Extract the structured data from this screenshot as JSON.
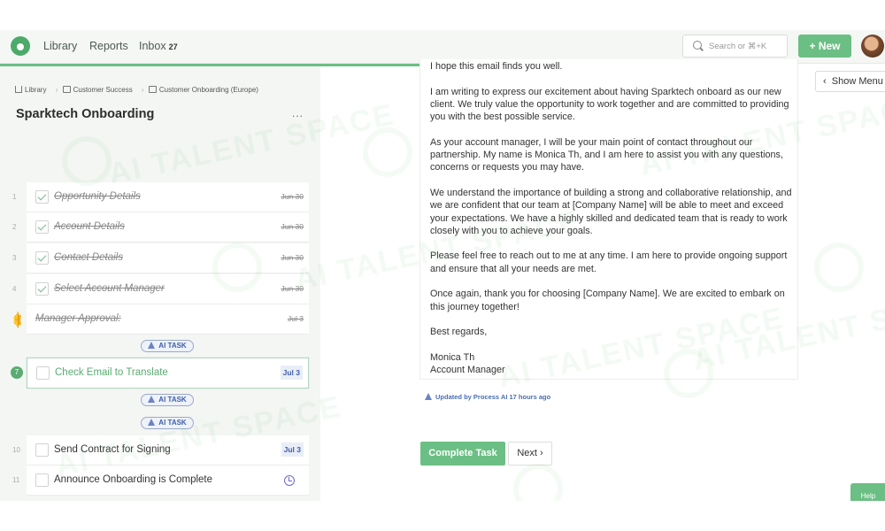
{
  "topbar": {
    "nav": [
      {
        "label": "Library"
      },
      {
        "label": "Reports"
      },
      {
        "label": "Inbox",
        "badge": "27"
      }
    ],
    "search_placeholder": "Search or ⌘+K",
    "new_label": "+ New"
  },
  "breadcrumb": {
    "items": [
      "Library",
      "Customer Success",
      "Customer Onboarding (Europe)"
    ]
  },
  "project": {
    "title": "Sparktech Onboarding",
    "more": "..."
  },
  "tasks": [
    {
      "num": "1",
      "label": "Opportunity Details",
      "date": "Jun 30"
    },
    {
      "num": "2",
      "label": "Account Details",
      "date": "Jun 30"
    },
    {
      "num": "3",
      "label": "Contact Details",
      "date": "Jun 30"
    },
    {
      "num": "4",
      "label": "Select Account Manager",
      "date": "Jun 30"
    },
    {
      "label": "Manager Approval:",
      "date": "Jul 3"
    },
    {
      "num": "7",
      "label": "Check Email to Translate",
      "date": "Jul 3"
    },
    {
      "num": "10",
      "label": "Send Contract for Signing",
      "date": "Jul 3"
    },
    {
      "num": "11",
      "label": "Announce Onboarding is Complete"
    }
  ],
  "ai_task_label": "AI TASK",
  "email": {
    "paragraphs": [
      "I hope this email finds you well.",
      "I am writing to express our excitement about having Sparktech onboard as our new client. We truly value the opportunity to work together and are committed to providing you with the best possible service.",
      "As your account manager, I will be your main point of contact throughout our partnership. My name is Monica Th, and I am here to assist you with any questions, concerns or requests you may have.",
      "We understand the importance of building a strong and collaborative relationship, and we are confident that our team at [Company Name] will be able to meet and exceed your expectations. We have a highly skilled and dedicated team that is ready to work closely with you to achieve your goals.",
      "Please feel free to reach out to me at any time. I am here to provide ongoing support and ensure that all your needs are met.",
      "Once again, thank you for choosing [Company Name]. We are excited to embark on this journey together!",
      "Best regards,"
    ],
    "signature_name": "Monica Th",
    "signature_title": "Account Manager"
  },
  "updated_text": "Updated by Process AI 17 hours ago",
  "actions": {
    "complete": "Complete Task",
    "next": "Next"
  },
  "show_menu": "Show Menu",
  "help": "Help",
  "watermark": "AI TALENT SPACE",
  "colors": {
    "accent": "#6bbf84",
    "ai_blue": "#3f5fa8",
    "date_chip_bg": "#e9edf7"
  }
}
